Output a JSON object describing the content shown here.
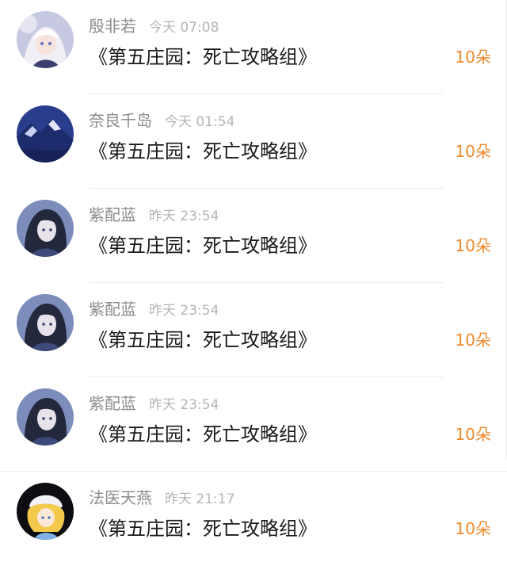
{
  "items": [
    {
      "name": "殷非若",
      "time": "今天 07:08",
      "gift": "《第五庄园：死亡攻略组》",
      "count": "10朵",
      "avatar_icon": "anime-girl-white-hair-avatar"
    },
    {
      "name": "奈良千岛",
      "time": "今天 01:54",
      "gift": "《第五庄园：死亡攻略组》",
      "count": "10朵",
      "avatar_icon": "blue-landscape-avatar"
    },
    {
      "name": "紫配蓝",
      "time": "昨天 23:54",
      "gift": "《第五庄园：死亡攻略组》",
      "count": "10朵",
      "avatar_icon": "dark-hair-character-avatar"
    },
    {
      "name": "紫配蓝",
      "time": "昨天 23:54",
      "gift": "《第五庄园：死亡攻略组》",
      "count": "10朵",
      "avatar_icon": "dark-hair-character-avatar"
    },
    {
      "name": "紫配蓝",
      "time": "昨天 23:54",
      "gift": "《第五庄园：死亡攻略组》",
      "count": "10朵",
      "avatar_icon": "dark-hair-character-avatar"
    },
    {
      "name": "法医天燕",
      "time": "昨天 21:17",
      "gift": "《第五庄园：死亡攻略组》",
      "count": "10朵",
      "avatar_icon": "blonde-character-avatar"
    }
  ],
  "colors": {
    "accent": "#f08a2c",
    "name": "#8c8c8c",
    "time": "#b5b5b5",
    "text": "#1a1a1a"
  }
}
